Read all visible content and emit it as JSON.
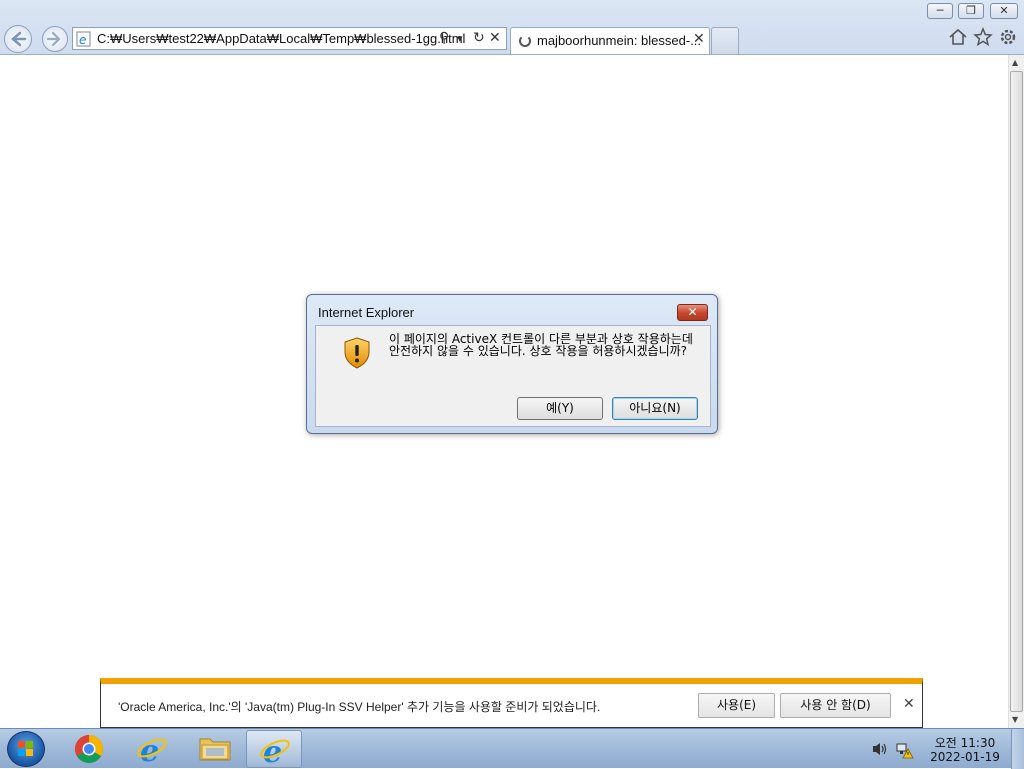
{
  "window": {
    "minimize": "─",
    "restore": "❐",
    "close": "✕"
  },
  "address_bar": {
    "url": "C:₩Users₩test22₩AppData₩Local₩Temp₩blessed-1gg.html",
    "search_glyph": "⚲",
    "dropdown_glyph": "▾",
    "refresh_glyph": "↻",
    "stop_glyph": "✕"
  },
  "tab": {
    "title": "majboorhunmein: blessed-...",
    "close_glyph": "✕"
  },
  "dialog": {
    "title": "Internet Explorer",
    "close_glyph": "✕",
    "message": "이 페이지의 ActiveX 컨트롤이 다른 부분과 상호 작용하는데 안전하지 않을 수 있습니다. 상호 작용을 허용하시겠습니까?",
    "yes_label": "예(Y)",
    "no_label": "아니요(N)"
  },
  "notification": {
    "message": "'Oracle America, Inc.'의 'Java(tm) Plug-In SSV Helper' 추가 기능을 사용할 준비가 되었습니다.",
    "enable_label": "사용(E)",
    "disable_label": "사용 안 함(D)",
    "close_glyph": "✕"
  },
  "scrollbar": {
    "up_glyph": "▲",
    "down_glyph": "▼"
  },
  "taskbar": {
    "time": "오전 11:30",
    "date": "2022-01-19"
  },
  "colors": {
    "notification_accent": "#f2a200",
    "dialog_close_red": "#c4452c",
    "ie_blue": "#1e82d8"
  }
}
